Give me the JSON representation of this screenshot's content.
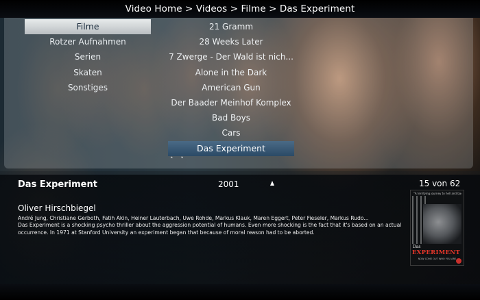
{
  "breadcrumb": "Video Home > Videos > Filme > Das Experiment",
  "sidebar": {
    "items": [
      {
        "label": "Filme",
        "selected": true
      },
      {
        "label": "Rotzer Aufnahmen"
      },
      {
        "label": "Serien"
      },
      {
        "label": "Skaten"
      },
      {
        "label": "Sonstiges"
      }
    ]
  },
  "titles": {
    "items": [
      {
        "label": "21 Gramm"
      },
      {
        "label": "28 Weeks Later"
      },
      {
        "label": "7 Zwerge - Der Wald ist nich..."
      },
      {
        "label": "Alone in the Dark"
      },
      {
        "label": "American Gun"
      },
      {
        "label": "Der Baader Meinhof Komplex"
      },
      {
        "label": "Bad Boys"
      },
      {
        "label": "Cars"
      },
      {
        "label": "Das Experiment",
        "focused": true
      }
    ],
    "scroll_arrows": "˄ ˅"
  },
  "details": {
    "title": "Das Experiment",
    "year": "2001",
    "position": "15 von 62",
    "director": "Oliver Hirschbiegel",
    "cast": "André Jung, Christiane Gerboth, Fatih Akin, Heiner Lauterbach, Uwe Rohde, Markus Klauk, Maren Eggert, Peter Fieseler, Markus Rudo...",
    "plot": "Das Experiment is a shocking psycho thriller about the aggression potential of humans. Even more shocking is the fact that it's based on an actual occurrence. In 1971 at Stanford University an experiment began that because of moral reason had to be aborted."
  },
  "poster": {
    "tagline": "\"A terrifying journey to hell and back\"",
    "das": "Das",
    "title": "EXPERIMENT",
    "bottom": "NOW COME OUT WHO YOU ARE"
  },
  "colors": {
    "selected_bg": "#d5d9db",
    "focused_bg": "#3a5a76",
    "panel_overlay": "#000000"
  }
}
